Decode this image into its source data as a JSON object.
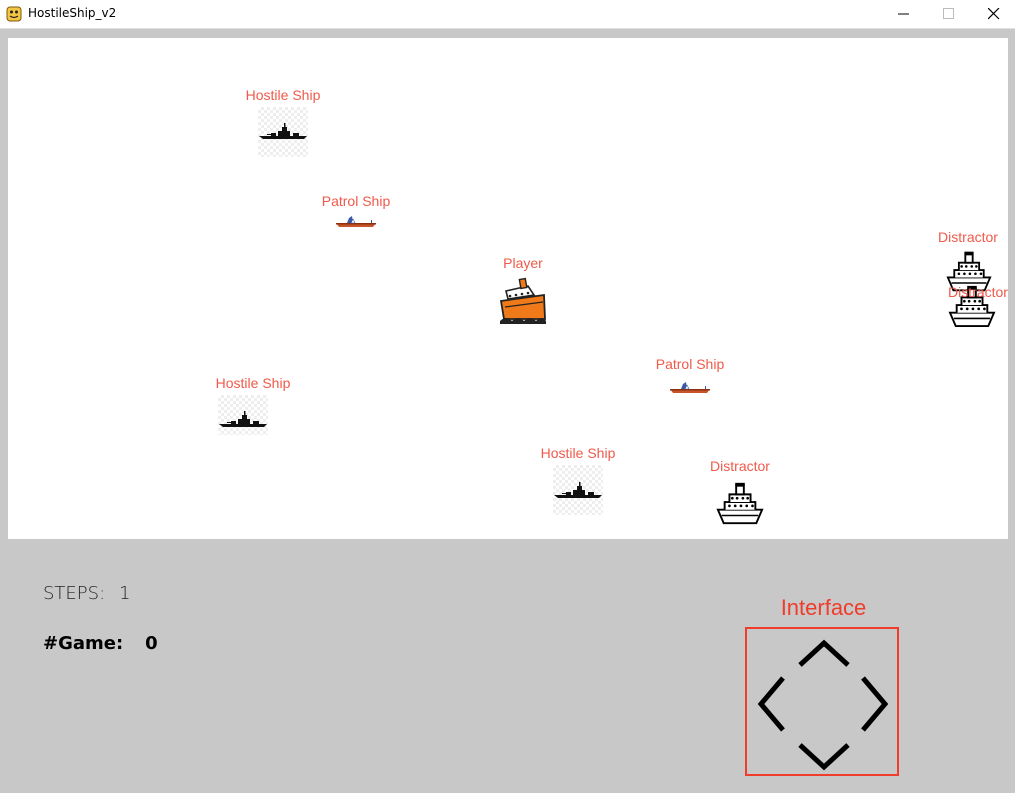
{
  "window": {
    "title": "HostileShip_v2",
    "icons": [
      "python-app-icon",
      "minimize-icon",
      "maximize-icon",
      "close-icon"
    ]
  },
  "board": {
    "entities": [
      {
        "id": "hostile-1",
        "label": "Hostile Ship",
        "kind": "hostile"
      },
      {
        "id": "patrol-1",
        "label": "Patrol Ship",
        "kind": "patrol"
      },
      {
        "id": "player",
        "label": "Player",
        "kind": "player"
      },
      {
        "id": "distractor-1",
        "label": "Distractor",
        "kind": "distractor"
      },
      {
        "id": "distractor-2",
        "label": "Distractor",
        "kind": "distractor"
      },
      {
        "id": "patrol-2",
        "label": "Patrol Ship",
        "kind": "patrol"
      },
      {
        "id": "hostile-2",
        "label": "Hostile Ship",
        "kind": "hostile"
      },
      {
        "id": "hostile-3",
        "label": "Hostile Ship",
        "kind": "hostile"
      },
      {
        "id": "distractor-3",
        "label": "Distractor",
        "kind": "distractor"
      }
    ]
  },
  "stats": {
    "steps_label": "STEPS:",
    "steps_value": "1",
    "games_label": "#Game:",
    "games_value": "0"
  },
  "interface": {
    "title": "Interface",
    "controls": [
      "arrow-up-icon",
      "arrow-left-icon",
      "arrow-right-icon",
      "arrow-down-icon"
    ]
  },
  "colors": {
    "label": "#f05a4a",
    "interface_accent": "#f03c2a",
    "board_bg": "#ffffff",
    "panel_bg": "#c8c8c8"
  }
}
